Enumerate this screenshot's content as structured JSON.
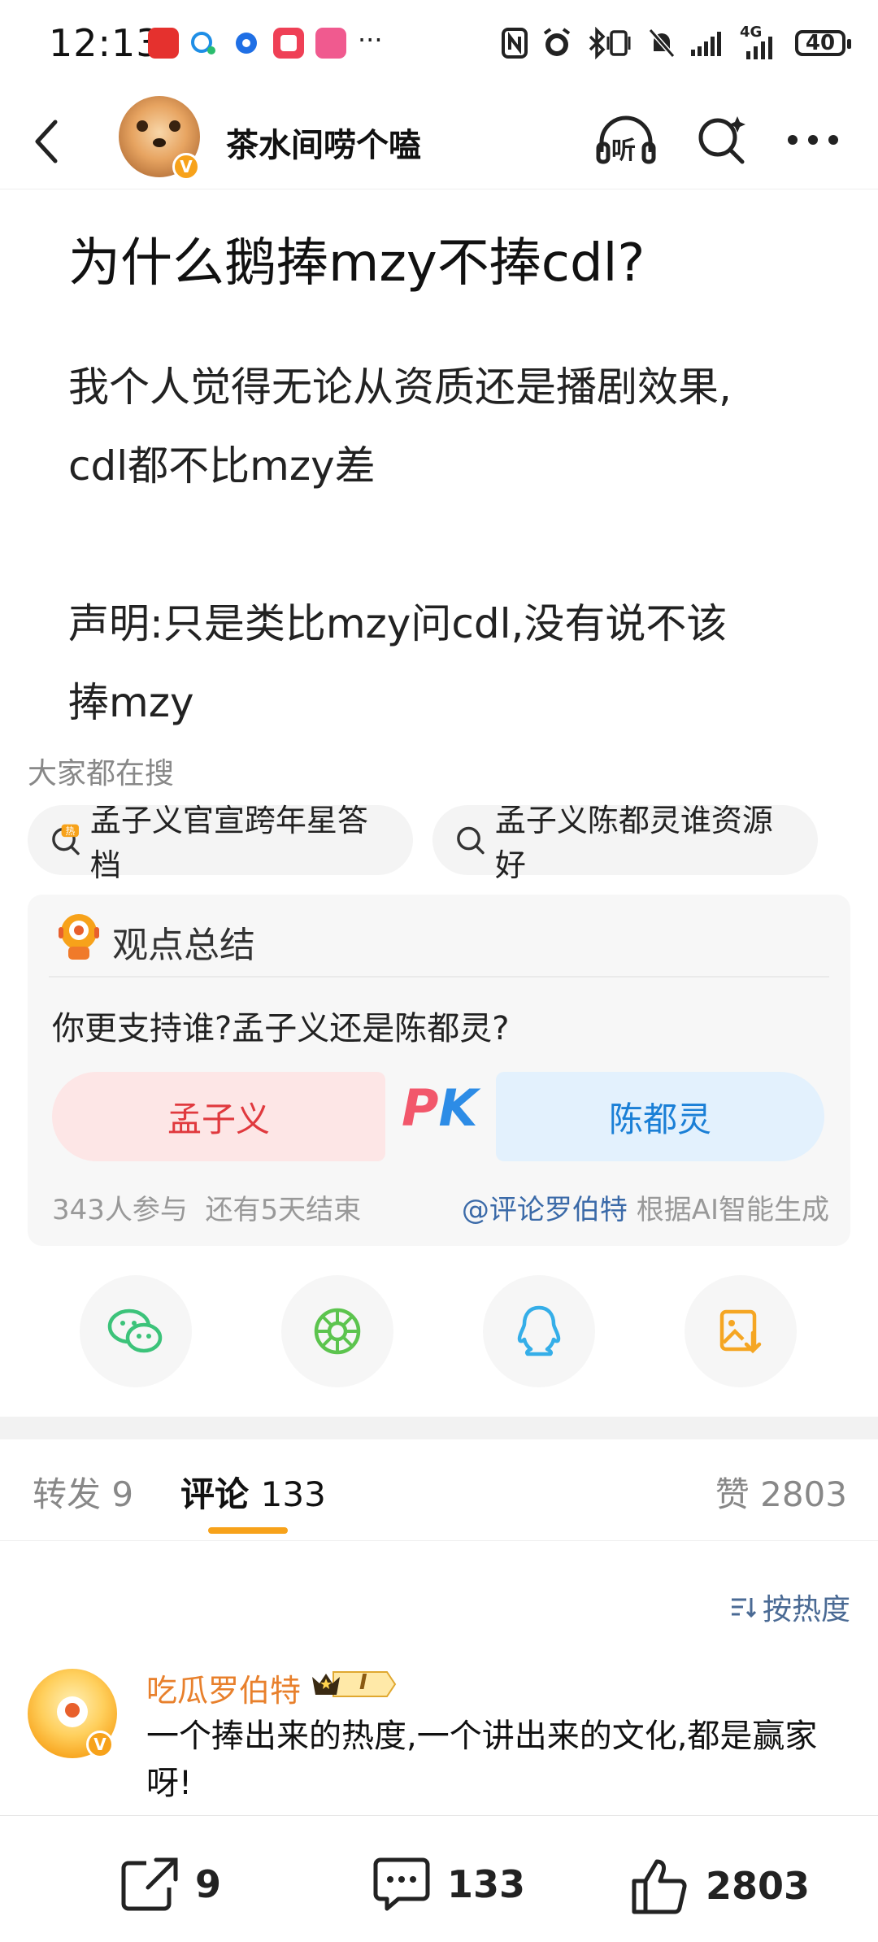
{
  "status_bar": {
    "time": "12:13",
    "more": "···",
    "network": "4G",
    "battery": "40"
  },
  "header": {
    "account_name": "茶水间唠个嗑",
    "verified_mark": "V",
    "listen_label": "听"
  },
  "post": {
    "title": "为什么鹅捧mzy不捧cdl?",
    "body_line1": "我个人觉得无论从资质还是播剧效果,",
    "body_line2": "cdl都不比mzy差",
    "body_line3": "声明:只是类比mzy问cdl,没有说不该",
    "body_line4": "捧mzy"
  },
  "search": {
    "hint": "大家都在搜",
    "chips": [
      {
        "label": "孟子义官宣跨年星答档",
        "icon": "hot-search-icon"
      },
      {
        "label": "孟子义陈都灵谁资源好",
        "icon": "search-icon"
      }
    ]
  },
  "summary": {
    "title": "观点总结",
    "question": "你更支持谁?孟子义还是陈都灵?",
    "option_left": "孟子义",
    "option_right": "陈都灵",
    "pk_p": "P",
    "pk_k": "K",
    "participants": "343人参与",
    "remaining": "还有5天结束",
    "generator": "@评论罗伯特",
    "generator_note": " 根据AI智能生成"
  },
  "share": [
    "wechat-icon",
    "moments-icon",
    "qq-icon",
    "save-image-icon"
  ],
  "tabs": {
    "repost_label": "转发",
    "repost_count": "9",
    "comments_label": "评论",
    "comments_count": "133",
    "likes_label": "赞",
    "likes_count": "2803"
  },
  "sort": {
    "label": "按热度"
  },
  "comment": {
    "user": "吃瓜罗伯特",
    "level_badge": "I",
    "text": "一个捧出来的热度,一个讲出来的文化,都是赢家呀!"
  },
  "bottom_bar": {
    "repost_count": "9",
    "comment_count": "133",
    "like_count": "2803"
  },
  "colors": {
    "accent_orange": "#f7a21a",
    "pk_red": "#e0393e",
    "pk_blue": "#1a7fd6",
    "link_blue": "#3b6aa8"
  }
}
